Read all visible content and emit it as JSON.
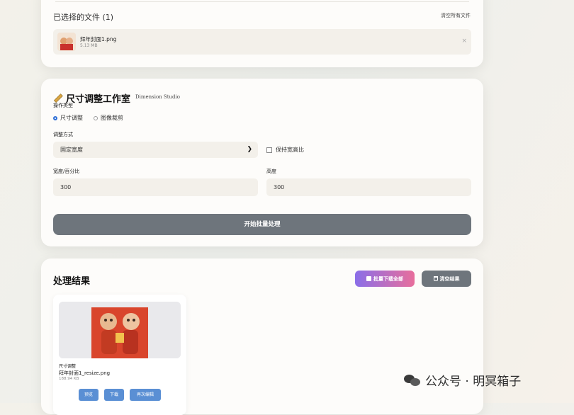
{
  "files": {
    "selected_title": "已选择的文件 (1)",
    "clear_all": "清空所有文件",
    "file": {
      "name": "拜年封面1.png",
      "size": "5.13 MB",
      "remove": "×"
    }
  },
  "studio": {
    "title": "尺寸调整工作室",
    "subtitle": "Dimension Studio",
    "op_type_label": "操作类型",
    "radio_resize": "尺寸调整",
    "radio_crop": "图像裁剪",
    "mode_label": "调整方式",
    "mode_value": "固定宽度",
    "keep_ratio": "保持宽高比",
    "width_label": "宽度/百分比",
    "width_value": "300",
    "height_label": "高度",
    "height_value": "300",
    "start_button": "开始批量处理"
  },
  "results": {
    "title": "处理结果",
    "download_all": "批量下载全部",
    "clear_results": "清空结果",
    "item": {
      "type": "尺寸调整",
      "name": "拜年封面1_resize.png",
      "size": "188.94 KB",
      "preview_btn": "预览",
      "download_btn": "下载",
      "edit_btn": "再次编辑"
    }
  },
  "watermark": {
    "text": "公众号 · 明冥箱子"
  },
  "colors": {
    "accent_blue": "#2f6fd6",
    "gray_button": "#6e757c",
    "small_button": "#5a8fd4"
  }
}
